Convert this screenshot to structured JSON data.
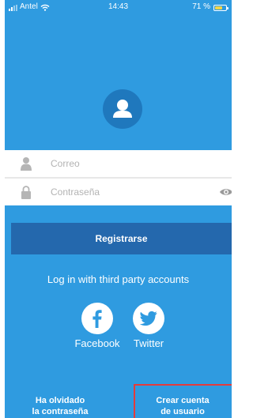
{
  "status_bar": {
    "carrier": "Antel",
    "time": "14:43",
    "battery_text": "71 %",
    "battery_level": 0.71
  },
  "login": {
    "user_placeholder": "Correo",
    "password_placeholder": "Contraseña",
    "register_label": "Registrarse"
  },
  "third_party": {
    "heading": "Log in with third party accounts",
    "facebook_label": "Facebook",
    "twitter_label": "Twitter"
  },
  "footer": {
    "forgot_line1": "Ha olvidado",
    "forgot_line2": "la contraseña",
    "create_line1": "Crear cuenta",
    "create_line2": "de usuario"
  },
  "colors": {
    "background": "#2f9be0",
    "avatar": "#1f78bd",
    "register_button": "#2468ad",
    "highlight_box": "#e53b3b"
  },
  "icons": [
    "signal-icon",
    "wifi-icon",
    "battery-icon",
    "avatar-icon",
    "user-icon",
    "lock-icon",
    "eye-icon",
    "facebook-icon",
    "twitter-icon"
  ]
}
